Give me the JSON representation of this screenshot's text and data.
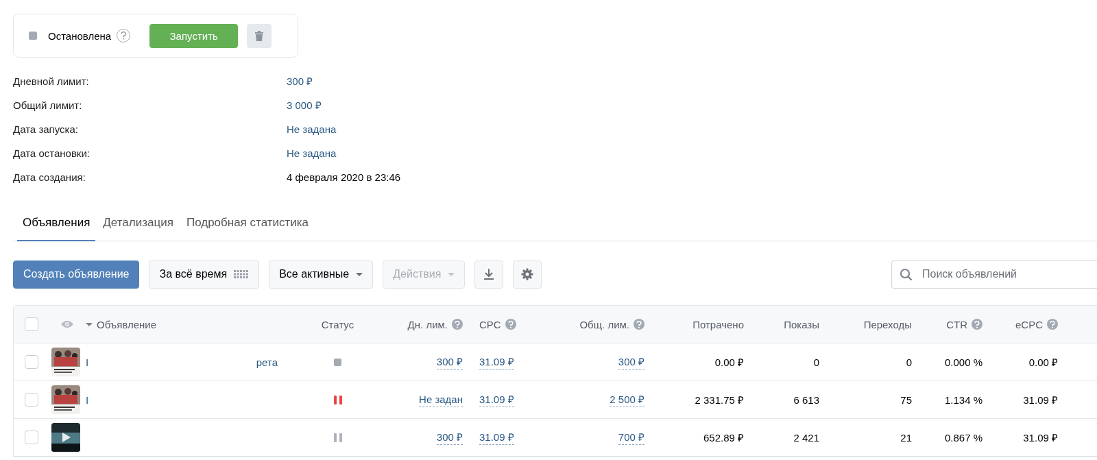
{
  "campaign": {
    "status_label": "Остановлена",
    "start_button": "Запустить"
  },
  "info": [
    {
      "label": "Дневной лимит:",
      "value": "300 ₽",
      "link": true
    },
    {
      "label": "Общий лимит:",
      "value": "3 000 ₽",
      "link": true
    },
    {
      "label": "Дата запуска:",
      "value": "Не задана",
      "link": true
    },
    {
      "label": "Дата остановки:",
      "value": "Не задана",
      "link": true
    },
    {
      "label": "Дата создания:",
      "value": "4 февраля 2020 в 23:46",
      "link": false
    }
  ],
  "tabs": [
    {
      "label": "Объявления",
      "selected": true
    },
    {
      "label": "Детализация",
      "selected": false
    },
    {
      "label": "Подробная статистика",
      "selected": false
    }
  ],
  "toolbar": {
    "create_button": "Создать объявление",
    "period": "За всё время",
    "filter": "Все активные",
    "actions": {
      "label": "Действия",
      "disabled": true
    },
    "search": {
      "placeholder": "Поиск объявлений"
    }
  },
  "table": {
    "select_all": {
      "checked": false
    },
    "columns": [
      {
        "label": "Объявление",
        "help": false,
        "sorted": true
      },
      {
        "label": "Статус",
        "help": false,
        "sorted": false
      },
      {
        "label": "Дн. лим.",
        "help": true,
        "sorted": false
      },
      {
        "label": "CPC",
        "help": true,
        "sorted": false
      },
      {
        "label": "Общ. лим.",
        "help": true,
        "sorted": false
      },
      {
        "label": "Потрачено",
        "help": false,
        "sorted": false
      },
      {
        "label": "Показы",
        "help": false,
        "sorted": false
      },
      {
        "label": "Переходы",
        "help": false,
        "sorted": false
      },
      {
        "label": "CTR",
        "help": true,
        "sorted": false
      },
      {
        "label": "eCPC",
        "help": true,
        "sorted": false
      }
    ],
    "rows": [
      {
        "checked": false,
        "name_start": "I",
        "name_end": "рета",
        "status": {
          "kind": "stopped",
          "color": "#a3aab4"
        },
        "day_limit": "300 ₽",
        "cpc": "31.09 ₽",
        "total_limit": "300 ₽",
        "spent": "0.00 ₽",
        "views": "0",
        "clicks": "0",
        "ctr": "0.000 %",
        "ecpc": "0.00 ₽"
      },
      {
        "checked": false,
        "name_start": "I",
        "status": {
          "kind": "paused",
          "color": "#e64646"
        },
        "day_limit": "Не задан",
        "cpc": "31.09 ₽",
        "total_limit": "2 500 ₽",
        "spent": "2 331.75 ₽",
        "views": "6 613",
        "clicks": "75",
        "ctr": "1.134 %",
        "ecpc": "31.09 ₽"
      },
      {
        "checked": false,
        "status": {
          "kind": "paused",
          "color": "#aeb3bb"
        },
        "day_limit": "300 ₽",
        "cpc": "31.09 ₽",
        "total_limit": "700 ₽",
        "spent": "652.89 ₽",
        "views": "2 421",
        "clicks": "21",
        "ctr": "0.867 %",
        "ecpc": "31.09 ₽"
      }
    ]
  }
}
